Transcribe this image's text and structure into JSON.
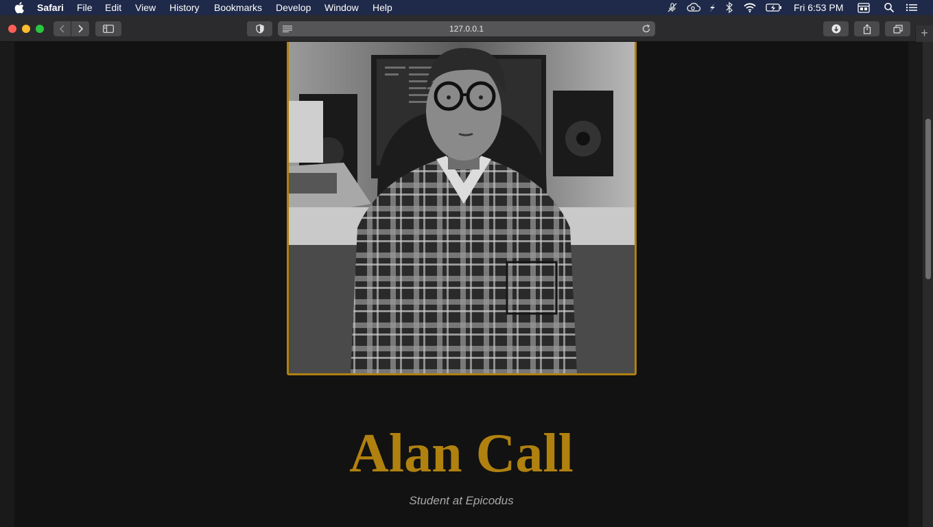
{
  "menubar": {
    "app_name": "Safari",
    "menus": [
      "File",
      "Edit",
      "View",
      "History",
      "Bookmarks",
      "Develop",
      "Window",
      "Help"
    ],
    "clock": "Fri 6:53 PM"
  },
  "toolbar": {
    "url": "127.0.0.1"
  },
  "profile": {
    "name": "Alan Call",
    "subtitle": "Student at Epicodus"
  },
  "colors": {
    "accent": "#b0810f",
    "page_bg": "#121212",
    "menubar_bg": "#1f2a4a"
  }
}
